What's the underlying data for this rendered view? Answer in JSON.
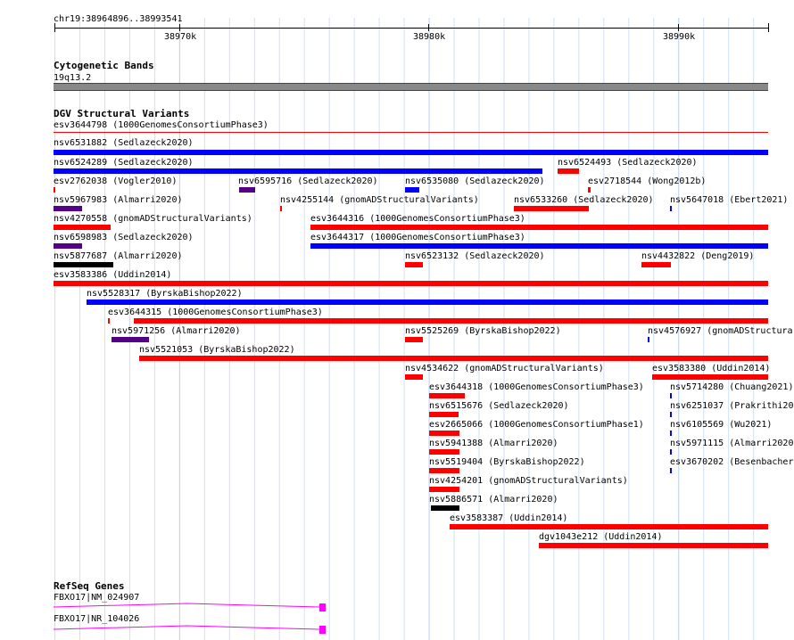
{
  "ruler": {
    "location": "chr19:38964896..38993541",
    "tick_labels": [
      "38970k",
      "38980k",
      "38990k"
    ]
  },
  "tracks": {
    "cytoband": {
      "title": "Cytogenetic Bands",
      "band_label": "19q13.2",
      "band_color": "#888888"
    },
    "dgv": {
      "title": "DGV Structural Variants",
      "colors": {
        "loss": "#ff0000",
        "gain": "#0000ff",
        "complex": "#550088",
        "other": "#000000"
      },
      "features": [
        "esv3644798 (1000GenomesConsortiumPhase3)",
        "nsv6531882 (Sedlazeck2020)",
        "nsv6524289 (Sedlazeck2020)",
        "nsv6524493 (Sedlazeck2020)",
        "esv2762038 (Vogler2010)",
        "nsv6595716 (Sedlazeck2020)",
        "nsv6535080 (Sedlazeck2020)",
        "esv2718544 (Wong2012b)",
        "nsv5967983 (Almarri2020)",
        "nsv4255144 (gnomADStructuralVariants)",
        "nsv6533260 (Sedlazeck2020)",
        "nsv5647018 (Ebert2021)",
        "nsv4270558 (gnomADStructuralVariants)",
        "esv3644316 (1000GenomesConsortiumPhase3)",
        "nsv6598983 (Sedlazeck2020)",
        "esv3644317 (1000GenomesConsortiumPhase3)",
        "nsv5877687 (Almarri2020)",
        "nsv6523132 (Sedlazeck2020)",
        "nsv4432822 (Deng2019)",
        "esv3583386 (Uddin2014)",
        "nsv5528317 (ByrskaBishop2022)",
        "esv3644315 (1000GenomesConsortiumPhase3)",
        "nsv5971256 (Almarri2020)",
        "nsv5525269 (ByrskaBishop2022)",
        "nsv4576927 (gnomADStructura",
        "nsv5521053 (ByrskaBishop2022)",
        "nsv4534622 (gnomADStructuralVariants)",
        "esv3583380 (Uddin2014)",
        "esv3644318 (1000GenomesConsortiumPhase3)",
        "nsv5714280 (Chuang2021)",
        "nsv6515676 (Sedlazeck2020)",
        "nsv6251037 (Prakrithi20",
        "esv2665066 (1000GenomesConsortiumPhase1)",
        "nsv6105569 (Wu2021)",
        "nsv5941388 (Almarri2020)",
        "nsv5971115 (Almarri2020",
        "nsv5519404 (ByrskaBishop2022)",
        "esv3670202 (Besenbacher",
        "nsv4254201 (gnomADStructuralVariants)",
        "nsv5886571 (Almarri2020)",
        "esv3583387 (Uddin2014)",
        "dgv1043e212 (Uddin2014)"
      ]
    },
    "refseq": {
      "title": "RefSeq Genes",
      "color": "#ff00ff",
      "features": [
        "FBXO17|NM_024907",
        "FBXO17|NR_104026"
      ]
    }
  }
}
